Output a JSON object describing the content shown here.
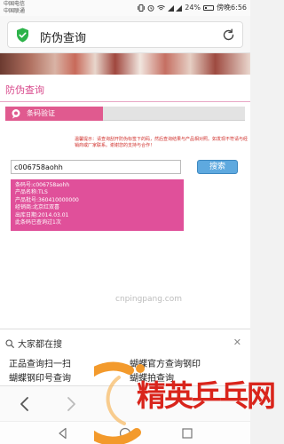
{
  "status_bar": {
    "carrier_line1": "中国电信",
    "carrier_line2": "中国联通",
    "battery_percent": "24%",
    "battery_level": 0.24,
    "time": "傍晚6:56"
  },
  "top_bar": {
    "page_name": "防伪查询"
  },
  "page": {
    "title": "防伪查询",
    "tab_label": "条码验证",
    "notice": "温馨提示：请查询刮开防伪标签下的码，然后查询结果与产品相对照。如发现不符请与经销商或厂家联系。谢谢您的支持与合作！",
    "code_value": "c006758aohh",
    "search_label": "搜索",
    "results": [
      "条码号:c006758aohh",
      "产品名称:TLS",
      "产品批号:360410000000",
      "经销商:北京红双喜",
      "出库日期:2014.03.01",
      "此条码已查询过1次"
    ]
  },
  "watermark_url": "cnpingpang.com",
  "suggestions": {
    "header": "大家都在搜",
    "items": [
      "正品查询扫一扫",
      "蝴蝶官方查询钢印",
      "蝴蝶钢印号查询",
      "蝴蝶拍查询"
    ]
  },
  "logo_text": "精英乒乓网",
  "colors": {
    "brand_pink": "#e05a8f",
    "result_bg": "#e0509a",
    "button_blue": "#5ea9df",
    "logo_red": "#d9251c",
    "shield_green": "#2db34a"
  }
}
